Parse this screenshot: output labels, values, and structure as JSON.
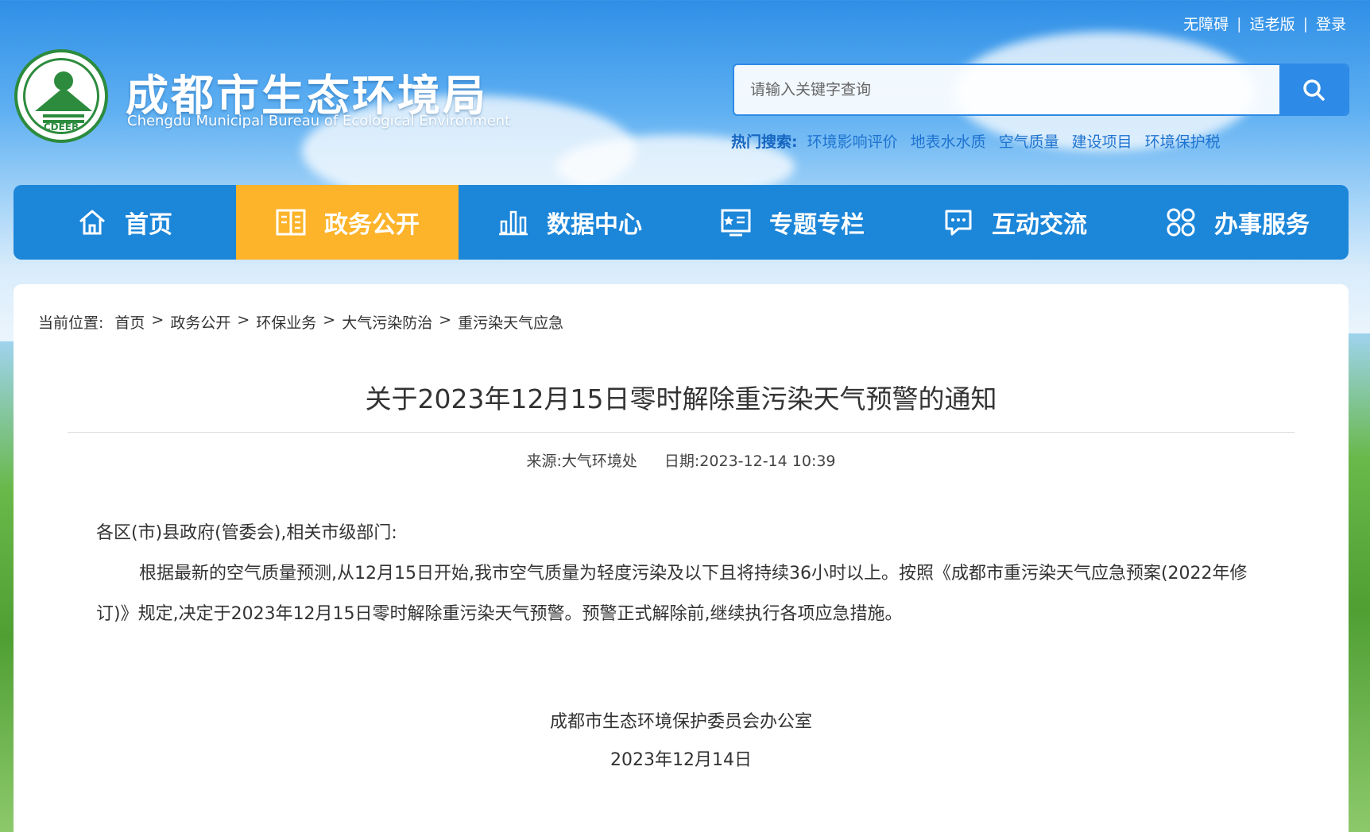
{
  "top_links": [
    "无障碍",
    "适老版",
    "登录"
  ],
  "logo": {
    "text": "CDEEB"
  },
  "site": {
    "title": "成都市生态环境局",
    "subtitle": "Chengdu Municipal Bureau of Ecological Environment"
  },
  "search": {
    "placeholder": "请输入关键字查询",
    "hot_label": "热门搜索:",
    "hot_items": [
      "环境影响评价",
      "地表水水质",
      "空气质量",
      "建设项目",
      "环境保护税"
    ]
  },
  "nav": [
    {
      "label": "首页",
      "icon": "home-icon",
      "active": false
    },
    {
      "label": "政务公开",
      "icon": "book-icon",
      "active": true
    },
    {
      "label": "数据中心",
      "icon": "bar-chart-icon",
      "active": false
    },
    {
      "label": "专题专栏",
      "icon": "board-icon",
      "active": false
    },
    {
      "label": "互动交流",
      "icon": "chat-icon",
      "active": false
    },
    {
      "label": "办事服务",
      "icon": "grid-icon",
      "active": false
    }
  ],
  "breadcrumb": {
    "label": "当前位置:",
    "items": [
      "首页",
      "政务公开",
      "环保业务",
      "大气污染防治",
      "重污染天气应急"
    ]
  },
  "article": {
    "title": "关于2023年12月15日零时解除重污染天气预警的通知",
    "source": "来源:大气环境处",
    "date": "日期:2023-12-14 10:39",
    "salutation": "各区(市)县政府(管委会),相关市级部门:",
    "paragraph": "根据最新的空气质量预测,从12月15日开始,我市空气质量为轻度污染及以下且将持续36小时以上。按照《成都市重污染天气应急预案(2022年修订)》规定,决定于2023年12月15日零时解除重污染天气预警。预警正式解除前,继续执行各项应急措施。",
    "signature": "成都市生态环境保护委员会办公室",
    "sign_date": "2023年12月14日"
  },
  "colors": {
    "nav_bg": "#1c86d9",
    "nav_active": "#fdb32a",
    "search_btn": "#2d8ae6",
    "logo_green": "#2c8b3d"
  }
}
